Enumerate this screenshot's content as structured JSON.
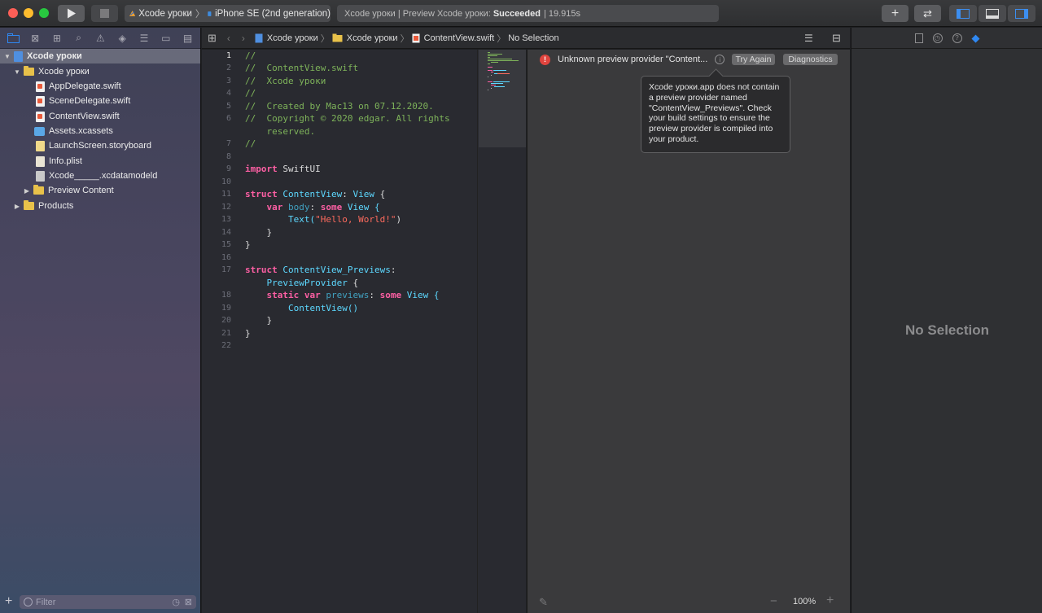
{
  "toolbar": {
    "scheme_target": "Xcode уроки",
    "device": "iPhone SE (2nd generation)",
    "activity_prefix": "Xcode уроки | Preview Xcode уроки:",
    "activity_status": "Succeeded",
    "activity_time": "| 19.915s"
  },
  "navigator": {
    "project": "Xcode уроки",
    "group": "Xcode уроки",
    "files": [
      "AppDelegate.swift",
      "SceneDelegate.swift",
      "ContentView.swift",
      "Assets.xcassets",
      "LaunchScreen.storyboard",
      "Info.plist",
      "Xcode_____.xcdatamodeld"
    ],
    "preview_group": "Preview Content",
    "products_group": "Products",
    "filter_placeholder": "Filter"
  },
  "jumpbar": {
    "crumbs": [
      "Xcode уроки",
      "Xcode уроки",
      "ContentView.swift",
      "No Selection"
    ]
  },
  "editor": {
    "line_numbers": [
      "1",
      "2",
      "3",
      "4",
      "5",
      "6",
      "7",
      "8",
      "9",
      "10",
      "11",
      "12",
      "13",
      "14",
      "15",
      "16",
      "17",
      "18",
      "19",
      "20",
      "21",
      "22"
    ],
    "lines": [
      "//",
      "//  ContentView.swift",
      "//  Xcode уроки",
      "//",
      "//  Created by Mac13 on 07.12.2020.",
      "//  Copyright © 2020 edgar. All rights",
      "    reserved.",
      "//",
      "import",
      "SwiftUI",
      "struct",
      "ContentView",
      "View",
      "var",
      "body",
      "some",
      "View {",
      "Text(",
      "\"Hello, World!\"",
      ")",
      "}",
      "}",
      "ContentView_Previews",
      "PreviewProvider",
      "static",
      "previews",
      "ContentView()",
      "}",
      "}"
    ]
  },
  "canvas": {
    "error_text": "Unknown preview provider \"Content...",
    "try_again": "Try Again",
    "diagnostics": "Diagnostics",
    "popover_text": "Xcode уроки.app does not contain a preview provider named \"ContentView_Previews\". Check your build settings to ensure the preview provider is compiled into your product.",
    "zoom": "100%"
  },
  "inspector": {
    "empty_text": "No Selection"
  },
  "colors": {
    "accent": "#1a7ef2",
    "error": "#e0443e",
    "comment": "#7eb35a",
    "keyword": "#fc5fa3",
    "type": "#5dd8ff",
    "string": "#fc6a5d"
  }
}
